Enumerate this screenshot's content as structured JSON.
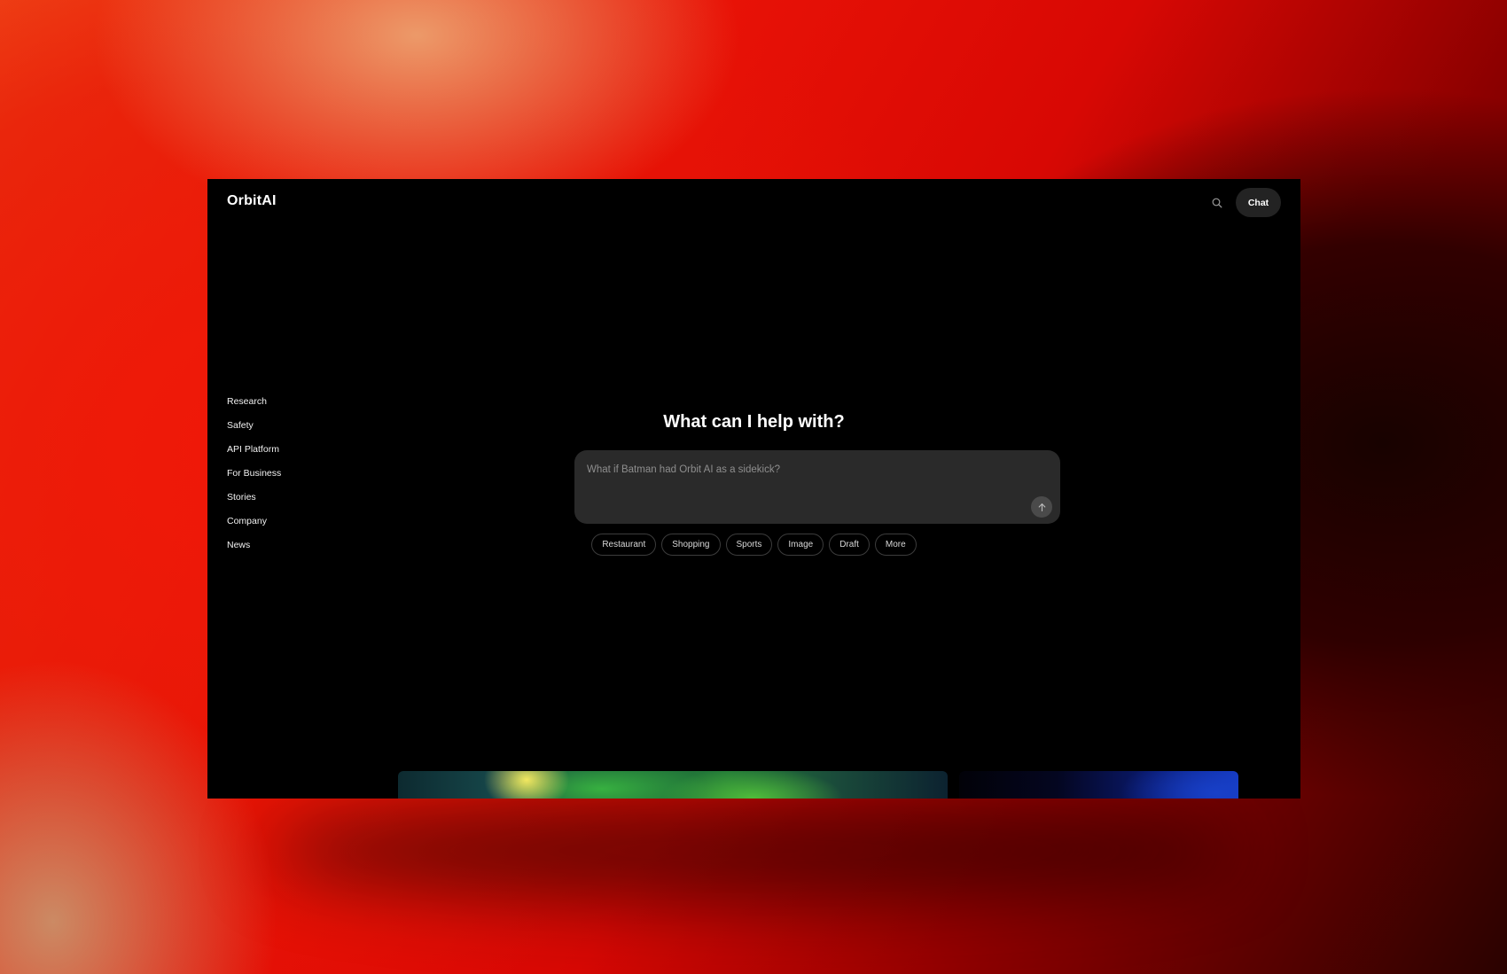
{
  "app": {
    "logo": "OrbitAI"
  },
  "header": {
    "search_icon": "search-icon",
    "chat_label": "Chat"
  },
  "sidebar": {
    "items": [
      {
        "label": "Research"
      },
      {
        "label": "Safety"
      },
      {
        "label": "API Platform"
      },
      {
        "label": "For Business"
      },
      {
        "label": "Stories"
      },
      {
        "label": "Company"
      },
      {
        "label": "News"
      }
    ]
  },
  "main": {
    "heading": "What can I help with?",
    "prompt": {
      "placeholder": "What if Batman had Orbit AI as a sidekick?",
      "value": "",
      "send_icon": "arrow-up-icon"
    },
    "chips": [
      {
        "label": "Restaurant"
      },
      {
        "label": "Shopping"
      },
      {
        "label": "Sports"
      },
      {
        "label": "Image"
      },
      {
        "label": "Draft"
      },
      {
        "label": "More"
      }
    ]
  },
  "colors": {
    "window_background": "#000000",
    "input_background": "#2a2a2a",
    "chip_border": "#3c3c3c",
    "backdrop_primary": "#e81206",
    "backdrop_highlight": "#ec9a6a",
    "card_green": "#237a38",
    "card_yellow": "#f2e860",
    "card_blue": "#1438c0"
  }
}
